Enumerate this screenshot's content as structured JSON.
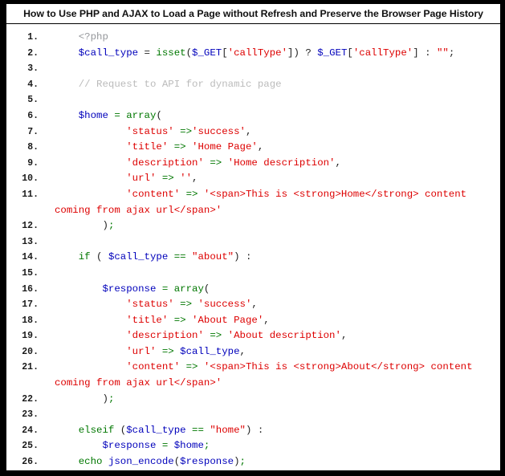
{
  "title": {
    "text": "How to Use PHP and AJAX to Load a Page without Refresh and Preserve the Browser Page History"
  },
  "colors": {
    "background": "#000000",
    "panel": "#ffffff",
    "border": "#000000",
    "title_text": "#111111",
    "line_number": "#1a1a1a",
    "keyword": "#007700",
    "variable": "#0000bb",
    "function": "#0000bb",
    "string": "#dd0000",
    "comment": "#bbbbbb",
    "php_tag": "#96989c",
    "plain": "#222222"
  },
  "code": {
    "language": "php",
    "line_number_suffix": ".",
    "lines": [
      {
        "number": "1",
        "tokens": [
          {
            "t": "    ",
            "c": "plain"
          },
          {
            "t": "<?php",
            "c": "tag"
          }
        ]
      },
      {
        "number": "2",
        "tokens": [
          {
            "t": "    ",
            "c": "plain"
          },
          {
            "t": "$call_type",
            "c": "var"
          },
          {
            "t": " = ",
            "c": "plain"
          },
          {
            "t": "isset",
            "c": "kw"
          },
          {
            "t": "(",
            "c": "plain"
          },
          {
            "t": "$_GET",
            "c": "var"
          },
          {
            "t": "[",
            "c": "plain"
          },
          {
            "t": "'callType'",
            "c": "str"
          },
          {
            "t": "]) ? ",
            "c": "plain"
          },
          {
            "t": "$_GET",
            "c": "var"
          },
          {
            "t": "[",
            "c": "plain"
          },
          {
            "t": "'callType'",
            "c": "str"
          },
          {
            "t": "] : ",
            "c": "plain"
          },
          {
            "t": "\"\"",
            "c": "str"
          },
          {
            "t": ";",
            "c": "plain"
          }
        ]
      },
      {
        "number": "3",
        "tokens": []
      },
      {
        "number": "4",
        "tokens": [
          {
            "t": "    ",
            "c": "plain"
          },
          {
            "t": "// Request to API for dynamic page",
            "c": "cmt"
          }
        ]
      },
      {
        "number": "5",
        "tokens": []
      },
      {
        "number": "6",
        "tokens": [
          {
            "t": "    ",
            "c": "plain"
          },
          {
            "t": "$home",
            "c": "var"
          },
          {
            "t": " ",
            "c": "plain"
          },
          {
            "t": "=",
            "c": "kw"
          },
          {
            "t": " ",
            "c": "plain"
          },
          {
            "t": "array",
            "c": "kw"
          },
          {
            "t": "(",
            "c": "plain"
          }
        ]
      },
      {
        "number": "7",
        "tokens": [
          {
            "t": "            ",
            "c": "plain"
          },
          {
            "t": "'status'",
            "c": "str"
          },
          {
            "t": " ",
            "c": "plain"
          },
          {
            "t": "=>",
            "c": "kw"
          },
          {
            "t": "'success'",
            "c": "str"
          },
          {
            "t": ",",
            "c": "plain"
          }
        ]
      },
      {
        "number": "8",
        "tokens": [
          {
            "t": "            ",
            "c": "plain"
          },
          {
            "t": "'title'",
            "c": "str"
          },
          {
            "t": " ",
            "c": "plain"
          },
          {
            "t": "=>",
            "c": "kw"
          },
          {
            "t": " ",
            "c": "plain"
          },
          {
            "t": "'Home Page'",
            "c": "str"
          },
          {
            "t": ",",
            "c": "plain"
          }
        ]
      },
      {
        "number": "9",
        "tokens": [
          {
            "t": "            ",
            "c": "plain"
          },
          {
            "t": "'description'",
            "c": "str"
          },
          {
            "t": " ",
            "c": "plain"
          },
          {
            "t": "=>",
            "c": "kw"
          },
          {
            "t": " ",
            "c": "plain"
          },
          {
            "t": "'Home description'",
            "c": "str"
          },
          {
            "t": ",",
            "c": "plain"
          }
        ]
      },
      {
        "number": "10",
        "tokens": [
          {
            "t": "            ",
            "c": "plain"
          },
          {
            "t": "'url'",
            "c": "str"
          },
          {
            "t": " ",
            "c": "plain"
          },
          {
            "t": "=>",
            "c": "kw"
          },
          {
            "t": " ",
            "c": "plain"
          },
          {
            "t": "''",
            "c": "str"
          },
          {
            "t": ",",
            "c": "plain"
          }
        ]
      },
      {
        "number": "11",
        "tokens": [
          {
            "t": "            ",
            "c": "plain"
          },
          {
            "t": "'content'",
            "c": "str"
          },
          {
            "t": " ",
            "c": "plain"
          },
          {
            "t": "=>",
            "c": "kw"
          },
          {
            "t": " ",
            "c": "plain"
          },
          {
            "t": "'<span>This is <strong>Home</strong> content coming from ajax url</span>'",
            "c": "str"
          }
        ]
      },
      {
        "number": "12",
        "tokens": [
          {
            "t": "        ",
            "c": "plain"
          },
          {
            "t": ")",
            "c": "plain"
          },
          {
            "t": ";",
            "c": "kw"
          }
        ]
      },
      {
        "number": "13",
        "tokens": []
      },
      {
        "number": "14",
        "tokens": [
          {
            "t": "    ",
            "c": "plain"
          },
          {
            "t": "if",
            "c": "kw"
          },
          {
            "t": " ( ",
            "c": "plain"
          },
          {
            "t": "$call_type",
            "c": "var"
          },
          {
            "t": " ",
            "c": "plain"
          },
          {
            "t": "==",
            "c": "kw"
          },
          {
            "t": " ",
            "c": "plain"
          },
          {
            "t": "\"about\"",
            "c": "str"
          },
          {
            "t": ") :",
            "c": "plain"
          }
        ]
      },
      {
        "number": "15",
        "tokens": []
      },
      {
        "number": "16",
        "tokens": [
          {
            "t": "        ",
            "c": "plain"
          },
          {
            "t": "$response",
            "c": "var"
          },
          {
            "t": " ",
            "c": "plain"
          },
          {
            "t": "=",
            "c": "kw"
          },
          {
            "t": " ",
            "c": "plain"
          },
          {
            "t": "array",
            "c": "kw"
          },
          {
            "t": "(",
            "c": "plain"
          }
        ]
      },
      {
        "number": "17",
        "tokens": [
          {
            "t": "            ",
            "c": "plain"
          },
          {
            "t": "'status'",
            "c": "str"
          },
          {
            "t": " ",
            "c": "plain"
          },
          {
            "t": "=>",
            "c": "kw"
          },
          {
            "t": " ",
            "c": "plain"
          },
          {
            "t": "'success'",
            "c": "str"
          },
          {
            "t": ",",
            "c": "plain"
          }
        ]
      },
      {
        "number": "18",
        "tokens": [
          {
            "t": "            ",
            "c": "plain"
          },
          {
            "t": "'title'",
            "c": "str"
          },
          {
            "t": " ",
            "c": "plain"
          },
          {
            "t": "=>",
            "c": "kw"
          },
          {
            "t": " ",
            "c": "plain"
          },
          {
            "t": "'About Page'",
            "c": "str"
          },
          {
            "t": ",",
            "c": "plain"
          }
        ]
      },
      {
        "number": "19",
        "tokens": [
          {
            "t": "            ",
            "c": "plain"
          },
          {
            "t": "'description'",
            "c": "str"
          },
          {
            "t": " ",
            "c": "plain"
          },
          {
            "t": "=>",
            "c": "kw"
          },
          {
            "t": " ",
            "c": "plain"
          },
          {
            "t": "'About description'",
            "c": "str"
          },
          {
            "t": ",",
            "c": "plain"
          }
        ]
      },
      {
        "number": "20",
        "tokens": [
          {
            "t": "            ",
            "c": "plain"
          },
          {
            "t": "'url'",
            "c": "str"
          },
          {
            "t": " ",
            "c": "plain"
          },
          {
            "t": "=>",
            "c": "kw"
          },
          {
            "t": " ",
            "c": "plain"
          },
          {
            "t": "$call_type",
            "c": "var"
          },
          {
            "t": ",",
            "c": "plain"
          }
        ]
      },
      {
        "number": "21",
        "tokens": [
          {
            "t": "            ",
            "c": "plain"
          },
          {
            "t": "'content'",
            "c": "str"
          },
          {
            "t": " ",
            "c": "plain"
          },
          {
            "t": "=>",
            "c": "kw"
          },
          {
            "t": " ",
            "c": "plain"
          },
          {
            "t": "'<span>This is <strong>About</strong> content coming from ajax url</span>'",
            "c": "str"
          }
        ]
      },
      {
        "number": "22",
        "tokens": [
          {
            "t": "        ",
            "c": "plain"
          },
          {
            "t": ")",
            "c": "plain"
          },
          {
            "t": ";",
            "c": "kw"
          }
        ]
      },
      {
        "number": "23",
        "tokens": []
      },
      {
        "number": "24",
        "tokens": [
          {
            "t": "    ",
            "c": "plain"
          },
          {
            "t": "elseif",
            "c": "kw"
          },
          {
            "t": " (",
            "c": "plain"
          },
          {
            "t": "$call_type",
            "c": "var"
          },
          {
            "t": " ",
            "c": "plain"
          },
          {
            "t": "==",
            "c": "kw"
          },
          {
            "t": " ",
            "c": "plain"
          },
          {
            "t": "\"home\"",
            "c": "str"
          },
          {
            "t": ") :",
            "c": "plain"
          }
        ]
      },
      {
        "number": "25",
        "tokens": [
          {
            "t": "        ",
            "c": "plain"
          },
          {
            "t": "$response",
            "c": "var"
          },
          {
            "t": " ",
            "c": "plain"
          },
          {
            "t": "=",
            "c": "kw"
          },
          {
            "t": " ",
            "c": "plain"
          },
          {
            "t": "$home",
            "c": "var"
          },
          {
            "t": ";",
            "c": "kw"
          }
        ]
      },
      {
        "number": "26",
        "tokens": [
          {
            "t": "    ",
            "c": "plain"
          },
          {
            "t": "echo",
            "c": "kw"
          },
          {
            "t": " ",
            "c": "plain"
          },
          {
            "t": "json_encode",
            "c": "fn"
          },
          {
            "t": "(",
            "c": "plain"
          },
          {
            "t": "$response",
            "c": "var"
          },
          {
            "t": ")",
            "c": "plain"
          },
          {
            "t": ";",
            "c": "kw"
          }
        ]
      }
    ]
  }
}
